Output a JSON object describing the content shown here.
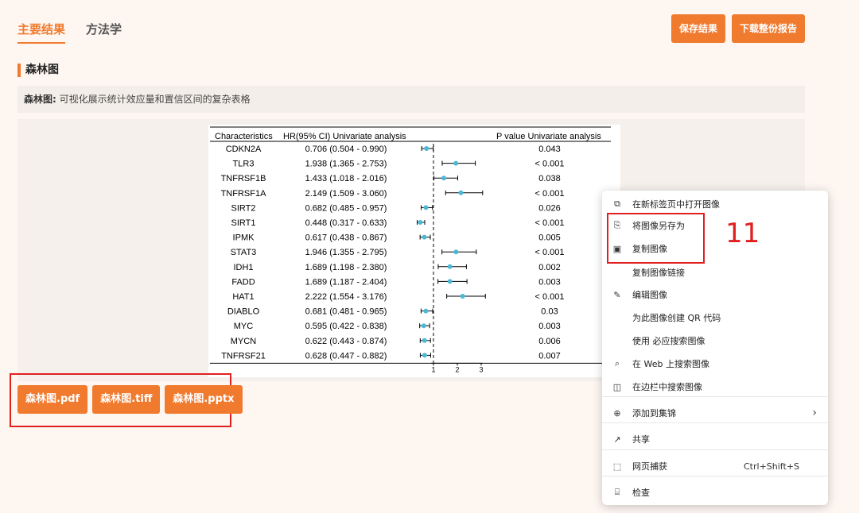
{
  "tabs": [
    {
      "label": "主要结果",
      "active": true
    },
    {
      "label": "方法学",
      "active": false
    }
  ],
  "actions": {
    "save": "保存结果",
    "download": "下载整份报告"
  },
  "section": {
    "title": "森林图",
    "desc_label": "森林图:",
    "desc_text": " 可视化展示统计效应量和置信区间的复杂表格"
  },
  "downloads": [
    "森林图.pdf",
    "森林图.tiff",
    "森林图.pptx"
  ],
  "annotation": "11",
  "colors": {
    "accent": "#f07a2e",
    "highlight": "#e02020",
    "point": "#4bb8d6"
  },
  "chart_data": {
    "type": "forest",
    "headers": [
      "Characteristics",
      "HR(95% CI) Univariate analysis",
      "P value Univariate analysis"
    ],
    "rows": [
      {
        "name": "CDKN2A",
        "ci_text": "0.706 (0.504 - 0.990)",
        "hr": 0.706,
        "lo": 0.504,
        "hi": 0.99,
        "p": "0.043"
      },
      {
        "name": "TLR3",
        "ci_text": "1.938 (1.365 - 2.753)",
        "hr": 1.938,
        "lo": 1.365,
        "hi": 2.753,
        "p": "< 0.001"
      },
      {
        "name": "TNFRSF1B",
        "ci_text": "1.433 (1.018 - 2.016)",
        "hr": 1.433,
        "lo": 1.018,
        "hi": 2.016,
        "p": "0.038"
      },
      {
        "name": "TNFRSF1A",
        "ci_text": "2.149 (1.509 - 3.060)",
        "hr": 2.149,
        "lo": 1.509,
        "hi": 3.06,
        "p": "< 0.001"
      },
      {
        "name": "SIRT2",
        "ci_text": "0.682 (0.485 - 0.957)",
        "hr": 0.682,
        "lo": 0.485,
        "hi": 0.957,
        "p": "0.026"
      },
      {
        "name": "SIRT1",
        "ci_text": "0.448 (0.317 - 0.633)",
        "hr": 0.448,
        "lo": 0.317,
        "hi": 0.633,
        "p": "< 0.001"
      },
      {
        "name": "IPMK",
        "ci_text": "0.617 (0.438 - 0.867)",
        "hr": 0.617,
        "lo": 0.438,
        "hi": 0.867,
        "p": "0.005"
      },
      {
        "name": "STAT3",
        "ci_text": "1.946 (1.355 - 2.795)",
        "hr": 1.946,
        "lo": 1.355,
        "hi": 2.795,
        "p": "< 0.001"
      },
      {
        "name": "IDH1",
        "ci_text": "1.689 (1.198 - 2.380)",
        "hr": 1.689,
        "lo": 1.198,
        "hi": 2.38,
        "p": "0.002"
      },
      {
        "name": "FADD",
        "ci_text": "1.689 (1.187 - 2.404)",
        "hr": 1.689,
        "lo": 1.187,
        "hi": 2.404,
        "p": "0.003"
      },
      {
        "name": "HAT1",
        "ci_text": "2.222 (1.554 - 3.176)",
        "hr": 2.222,
        "lo": 1.554,
        "hi": 3.176,
        "p": "< 0.001"
      },
      {
        "name": "DIABLO",
        "ci_text": "0.681 (0.481 - 0.965)",
        "hr": 0.681,
        "lo": 0.481,
        "hi": 0.965,
        "p": "0.03"
      },
      {
        "name": "MYC",
        "ci_text": "0.595 (0.422 - 0.838)",
        "hr": 0.595,
        "lo": 0.422,
        "hi": 0.838,
        "p": "0.003"
      },
      {
        "name": "MYCN",
        "ci_text": "0.622 (0.443 - 0.874)",
        "hr": 0.622,
        "lo": 0.443,
        "hi": 0.874,
        "p": "0.006"
      },
      {
        "name": "TNFRSF21",
        "ci_text": "0.628 (0.447 - 0.882)",
        "hr": 0.628,
        "lo": 0.447,
        "hi": 0.882,
        "p": "0.007"
      }
    ],
    "x_ticks": [
      1,
      2,
      3
    ],
    "xlim": [
      0,
      3.3
    ],
    "reference_line": 1
  },
  "context_menu": {
    "items": [
      {
        "icon": "open-new-tab-icon",
        "label": "在新标签页中打开图像"
      },
      {
        "icon": "save-image-icon",
        "label": "将图像另存为"
      },
      {
        "icon": "copy-image-icon",
        "label": "复制图像"
      },
      {
        "icon": "",
        "label": "复制图像链接"
      },
      {
        "icon": "edit-image-icon",
        "label": "编辑图像"
      },
      {
        "icon": "",
        "label": "为此图像创建 QR 代码"
      },
      {
        "icon": "",
        "label": "使用 必应搜索图像"
      },
      {
        "icon": "web-search-icon",
        "label": "在 Web 上搜索图像"
      },
      {
        "icon": "sidebar-search-icon",
        "label": "在边栏中搜索图像"
      },
      {
        "icon": "collections-icon",
        "label": "添加到集锦",
        "submenu": true
      },
      {
        "icon": "share-icon",
        "label": "共享"
      },
      {
        "icon": "screenshot-icon",
        "label": "网页捕获",
        "shortcut": "Ctrl+Shift+S"
      },
      {
        "icon": "inspect-icon",
        "label": "检查"
      }
    ]
  }
}
